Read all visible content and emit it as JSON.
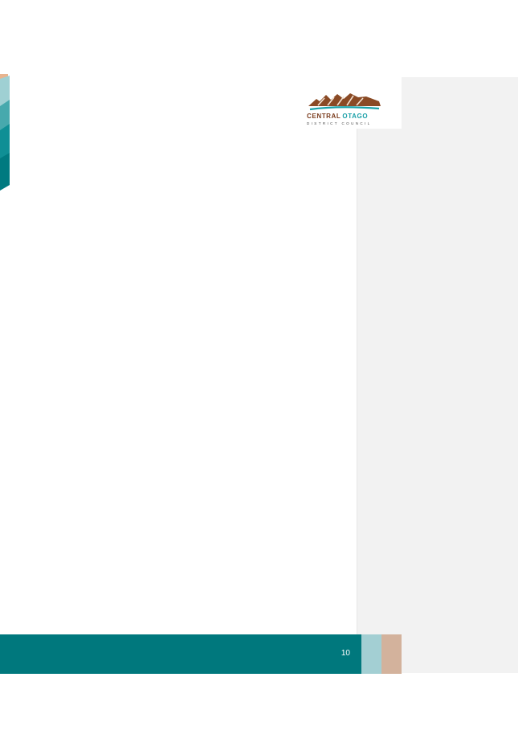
{
  "logo": {
    "line1_part1": "CENTRAL",
    "line1_part2": "OTAGO",
    "line2": "DISTRICT COUNCIL"
  },
  "footer": {
    "page_number": "10"
  },
  "colors": {
    "footer_band": "#00787d",
    "accent_teal": "#a3cfd3",
    "accent_tan": "#d3b29c",
    "comment_pane": "#f2f2f2"
  }
}
